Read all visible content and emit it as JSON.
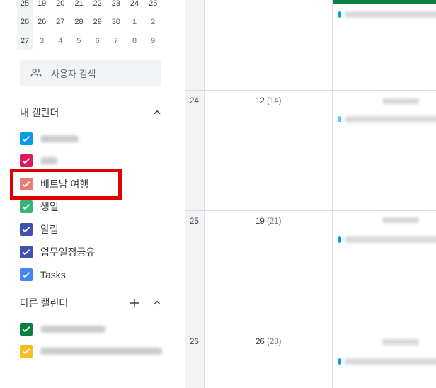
{
  "mini_calendar": {
    "rows": [
      {
        "week": "25",
        "days": [
          "19",
          "20",
          "21",
          "22",
          "23",
          "24",
          "25"
        ],
        "dim": [
          false,
          false,
          false,
          false,
          false,
          false,
          false
        ]
      },
      {
        "week": "26",
        "days": [
          "26",
          "27",
          "28",
          "29",
          "30",
          "1",
          "2"
        ],
        "dim": [
          false,
          false,
          false,
          false,
          false,
          true,
          true
        ]
      },
      {
        "week": "27",
        "days": [
          "3",
          "4",
          "5",
          "6",
          "7",
          "8",
          "9"
        ],
        "dim": [
          true,
          true,
          true,
          true,
          true,
          true,
          true
        ]
      }
    ]
  },
  "search": {
    "placeholder": "사용자 검색"
  },
  "my_calendars": {
    "title": "내 캘린더",
    "items": [
      {
        "label": "",
        "color": "#039be5",
        "redacted": true
      },
      {
        "label": "",
        "color": "#d81b60",
        "redacted": true
      },
      {
        "label": "베트남 여행",
        "color": "#e67c73"
      },
      {
        "label": "생일",
        "color": "#33b679"
      },
      {
        "label": "알림",
        "color": "#3f51b5"
      },
      {
        "label": "업무일정공유",
        "color": "#3f51b5"
      },
      {
        "label": "Tasks",
        "color": "#4285f4"
      }
    ]
  },
  "other_calendars": {
    "title": "다른 캘린더",
    "items": [
      {
        "label": "",
        "color": "#0b8043",
        "redacted": true
      },
      {
        "label": "",
        "color": "#f6bf26",
        "redacted": true
      }
    ]
  },
  "grid": {
    "weeks": [
      {
        "week": "24",
        "start": "12",
        "end": "(14)"
      },
      {
        "week": "25",
        "start": "19",
        "end": "(21)"
      },
      {
        "week": "26",
        "start": "26",
        "end": "(28)"
      }
    ]
  },
  "colors": {
    "highlight": "#e00000",
    "event_green": "#0b8043",
    "event_dot": "#039be5"
  },
  "icons": [
    "people-icon",
    "chevron-up-icon",
    "plus-icon",
    "check-icon"
  ]
}
